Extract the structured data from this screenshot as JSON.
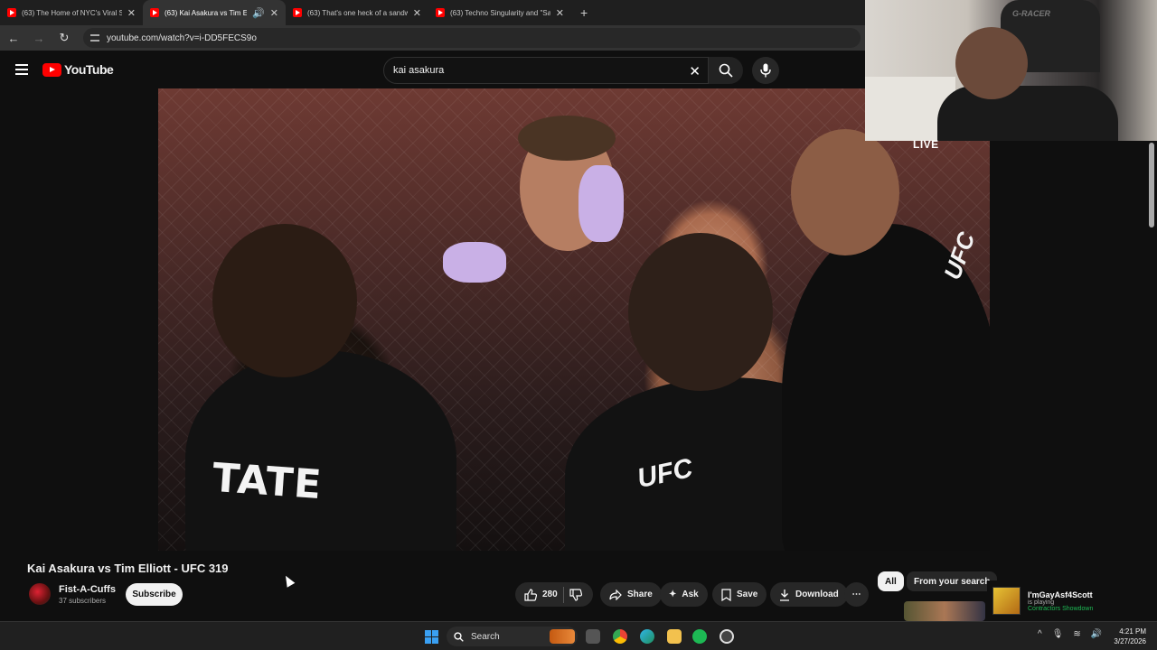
{
  "browser": {
    "tabs": [
      {
        "title": "(63) The Home of NYC's Viral S",
        "active": false
      },
      {
        "title": "(63) Kai Asakura vs Tim Elli",
        "active": true
      },
      {
        "title": "(63) That's one heck of a sandw",
        "active": false
      },
      {
        "title": "(63) Techno Singularity and \"Sa",
        "active": false
      }
    ],
    "url": "youtube.com/watch?v=i-DD5FECS9o"
  },
  "youtube": {
    "logo": "YouTube",
    "search_value": "kai asakura"
  },
  "video": {
    "overlay_texts": {
      "tate": "TATE",
      "ufc_left": "UFC",
      "ufc_right": "UFC"
    },
    "live_label": "LIVE",
    "webcam_brand": "G-RACER",
    "title": "Kai Asakura vs Tim Elliott - UFC 319",
    "channel": "Fist-A-Cuffs",
    "subscribers": "37 subscribers",
    "subscribe": "Subscribe",
    "likes": "280",
    "share": "Share",
    "ask": "Ask",
    "save": "Save",
    "download": "Download"
  },
  "chips": [
    "All",
    "From your search"
  ],
  "spotify": {
    "user": "I'mGayAsf4Scott",
    "status": "is playing",
    "game": "Contractors Showdown"
  },
  "taskbar": {
    "search": "Search",
    "time": "4:21 PM",
    "date": "3/27/2026"
  },
  "colors": {
    "brand_red": "#ff0000",
    "bg": "#0f0f0f",
    "chip_active": "#f1f1f1",
    "spotify_green": "#1db954"
  }
}
